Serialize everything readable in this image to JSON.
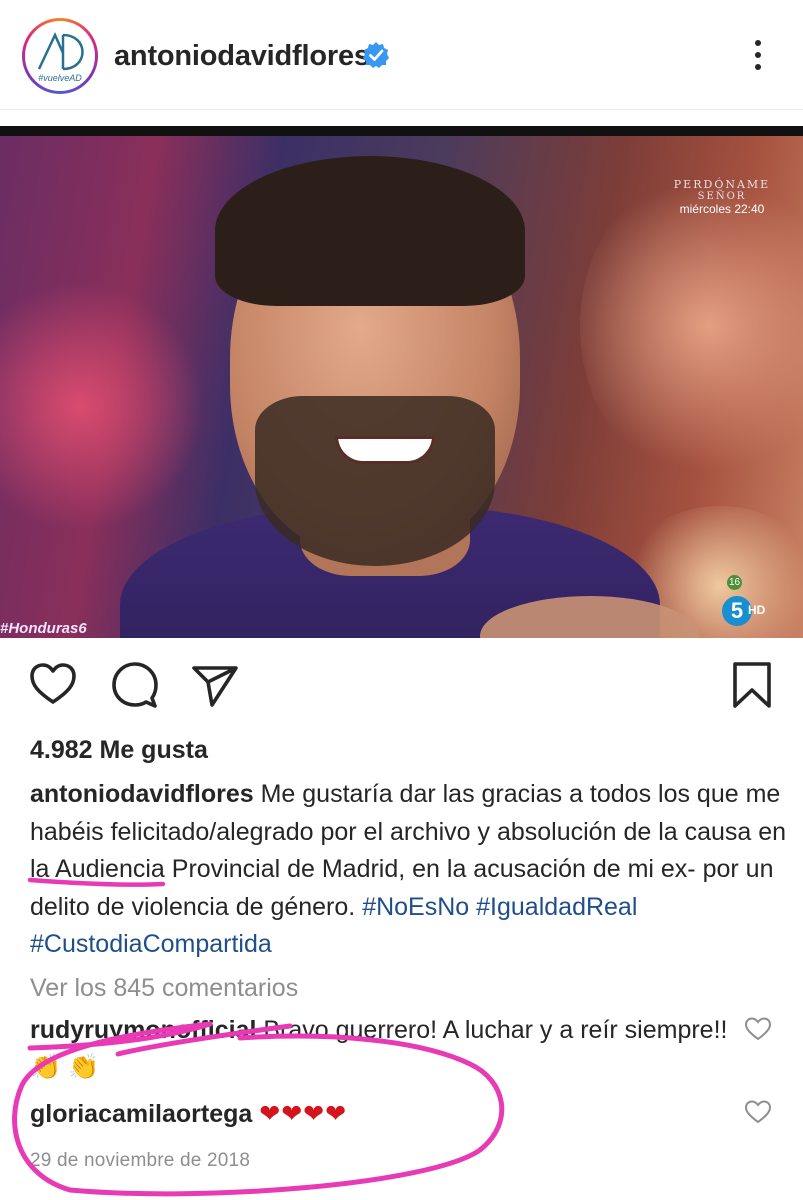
{
  "header": {
    "username": "antoniodavidflores",
    "avatar_text": "#vuelveAD",
    "verified_icon": "verified-badge-icon",
    "more_icon": "more-vertical-icon"
  },
  "photo": {
    "promo_line1": "PERDÓNAME",
    "promo_line2": "SEÑOR",
    "promo_line3": "miércoles 22:40",
    "rating": "16",
    "channel": "5",
    "channel_hd": "HD",
    "hashtag": "#Honduras6"
  },
  "actions": {
    "like_icon": "heart-icon",
    "comment_icon": "comment-icon",
    "share_icon": "send-icon",
    "save_icon": "bookmark-icon"
  },
  "post": {
    "likes": "4.982 Me gusta",
    "caption_user": "antoniodavidflores",
    "caption_part1": "Me gustaría dar las gracias a todos los que me habéis felicitado/alegrado por el archivo y",
    "caption_highlight": "absolución",
    "caption_part2": "de la causa en la Audiencia Provincial de Madrid, en la acusación de mi ex- por un delito de violencia de género.",
    "hashtags": [
      "#NoEsNo",
      "#IgualdadReal",
      "#CustodiaCompartida"
    ],
    "view_comments": "Ver los 845 comentarios",
    "date": "29 de noviembre de 2018"
  },
  "comments": [
    {
      "user": "rudyruymonofficial",
      "text": "Bravo guerrero! A luchar y a reír siempre!!",
      "emoji": "👏 👏"
    },
    {
      "user": "gloriacamilaortega",
      "text": "",
      "emoji": "❤❤❤❤"
    }
  ],
  "annotation_color": "#e83ab5"
}
